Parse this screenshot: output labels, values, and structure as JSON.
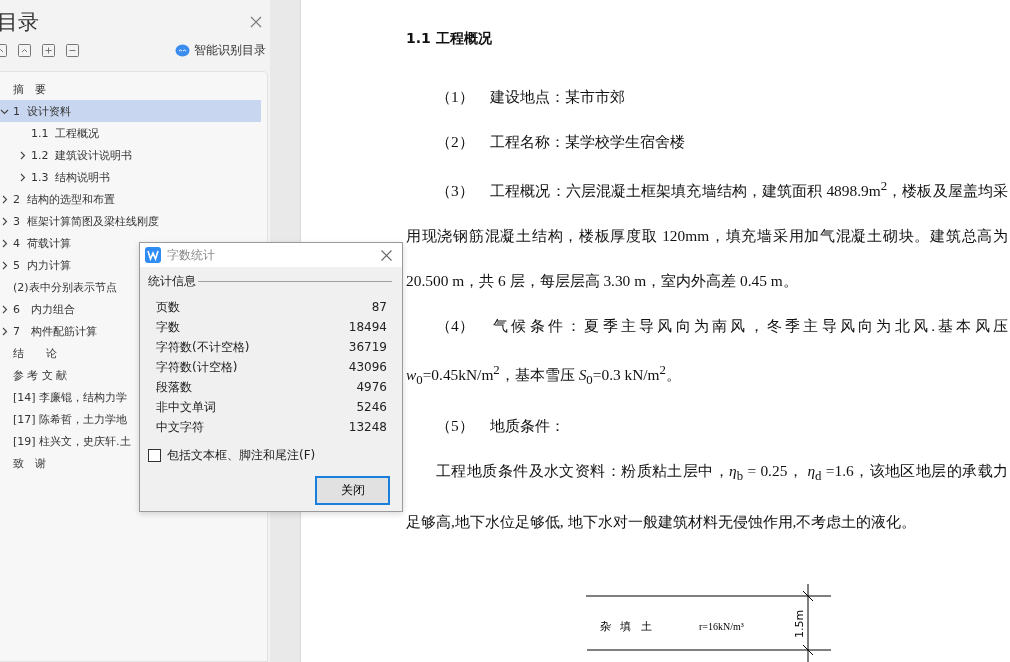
{
  "toc_panel": {
    "title": "目录",
    "smart_button": "智能识别目录",
    "items": [
      {
        "label": "摘　要",
        "selected": false
      },
      {
        "label": "1  设计资料",
        "expanded": true,
        "selected": true,
        "children": [
          {
            "label": "1.1  工程概况",
            "selected": false
          },
          {
            "label": "1.2  建筑设计说明书",
            "expanded": false,
            "selected": false
          },
          {
            "label": "1.3  结构说明书",
            "expanded": false,
            "selected": false
          }
        ]
      },
      {
        "label": "2  结构的选型和布置",
        "expanded": false,
        "selected": false
      },
      {
        "label": "3  框架计算简图及梁柱线刚度",
        "expanded": false,
        "selected": false
      },
      {
        "label": "4  荷载计算",
        "expanded": false,
        "selected": false
      },
      {
        "label": "5  内力计算",
        "expanded": false,
        "selected": false
      },
      {
        "label": "(2)表中分别表示节点",
        "selected": false
      },
      {
        "label": "6　内力组合",
        "expanded": false,
        "selected": false
      },
      {
        "label": "7　构件配筋计算",
        "expanded": false,
        "selected": false
      },
      {
        "label": "结　　论",
        "selected": false
      },
      {
        "label": "参 考 文 献",
        "selected": false
      },
      {
        "label": "[14] 李廉锟，结构力学",
        "selected": false
      },
      {
        "label": "[17] 陈希哲，土力学地",
        "selected": false
      },
      {
        "label": "[19] 柱兴文，史庆轩.土",
        "selected": false
      },
      {
        "label": "致　谢",
        "selected": false
      }
    ]
  },
  "document": {
    "heading": "1.1  工程概况",
    "paragraphs": [
      {
        "number": "（1）",
        "text": "建设地点：某市市郊"
      },
      {
        "number": "（2）",
        "text": "工程名称：某学校学生宿舍楼"
      },
      {
        "number": "（3）",
        "text": "工程概况：六层混凝土框架填充墙结构，建筑面积 4898.9m$^{2}$，楼板及屋盖均采用现浇钢筋混凝土结构，楼板厚度取 120mm，填充墙采用加气混凝土砌块。建筑总高为 20.500 m，共 6 层，每层层高 3.30 m，室内外高差 0.45 m。"
      },
      {
        "number": "（4）",
        "text": "气候条件：夏季主导风向为南风，冬季主导风向为北风.基本风压 *w*$_{0}$=0.45kN/m$^{2}$，基本雪压 *S*$_{0}$=0.3 kN/m$^{2}$。"
      },
      {
        "number": "（5）",
        "text": "地质条件："
      },
      {
        "text": "工程地质条件及水文资料：粉质粘土层中，*η*$_{b}$ = 0.25，  *η*$_{d}$ =1.6，该地区地层的承载力足够高,地下水位足够低, 地下水对一般建筑材料无侵蚀作用,不考虑土的液化。"
      }
    ],
    "figure": {
      "layer": "杂 填 土",
      "density": "r=16kN/m³",
      "thickness": "1.5m"
    }
  },
  "dialog": {
    "title": "字数统计",
    "group": "统计信息",
    "stats": [
      {
        "label": "页数",
        "value": "87"
      },
      {
        "label": "字数",
        "value": "18494"
      },
      {
        "label": "字符数(不计空格)",
        "value": "36719"
      },
      {
        "label": "字符数(计空格)",
        "value": "43096"
      },
      {
        "label": "段落数",
        "value": "4976"
      },
      {
        "label": "非中文单词",
        "value": "5246"
      },
      {
        "label": "中文字符",
        "value": "13248"
      }
    ],
    "checkbox": {
      "label": "包括文本框、脚注和尾注(F)",
      "checked": false
    },
    "close_button": "关闭"
  }
}
